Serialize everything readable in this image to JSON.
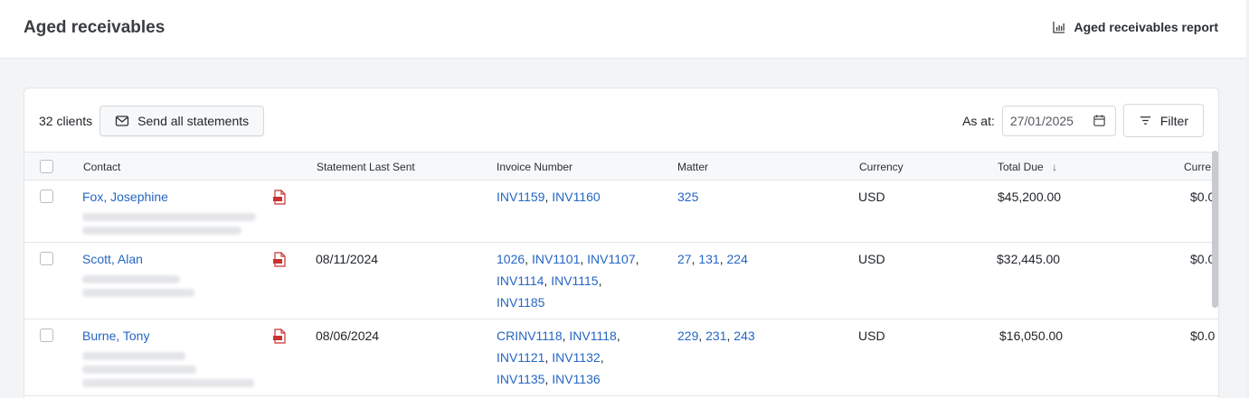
{
  "header": {
    "title": "Aged receivables",
    "report_link": "Aged receivables report"
  },
  "toolbar": {
    "client_count": "32 clients",
    "send_all_label": "Send all statements",
    "as_at_label": "As at:",
    "as_at_value": "27/01/2025",
    "filter_label": "Filter"
  },
  "table": {
    "columns": [
      "Contact",
      "Statement Last Sent",
      "Invoice Number",
      "Matter",
      "Currency",
      "Total Due",
      "Curre"
    ],
    "sort_column": "Total Due",
    "sort_direction": "descending",
    "rows": [
      {
        "contact": "Fox, Josephine",
        "statement_last_sent": "",
        "invoices": [
          "INV1159",
          "INV1160"
        ],
        "matters": [
          "325"
        ],
        "currency": "USD",
        "total_due": "$45,200.00",
        "current": "$0.0"
      },
      {
        "contact": "Scott, Alan",
        "statement_last_sent": "08/11/2024",
        "invoices": [
          "1026",
          "INV1101",
          "INV1107",
          "INV1114",
          "INV1115",
          "INV1185"
        ],
        "matters": [
          "27",
          "131",
          "224"
        ],
        "currency": "USD",
        "total_due": "$32,445.00",
        "current": "$0.0"
      },
      {
        "contact": "Burne, Tony",
        "statement_last_sent": "08/06/2024",
        "invoices": [
          "CRINV1118",
          "INV1118",
          "INV1121",
          "INV1132",
          "INV1135",
          "INV1136"
        ],
        "matters": [
          "229",
          "231",
          "243"
        ],
        "currency": "USD",
        "total_due": "$16,050.00",
        "current": "$0.0"
      }
    ]
  },
  "colors": {
    "link": "#2566c4",
    "pdf_icon": "#c8322f",
    "header_bg": "#f7f8f9"
  }
}
